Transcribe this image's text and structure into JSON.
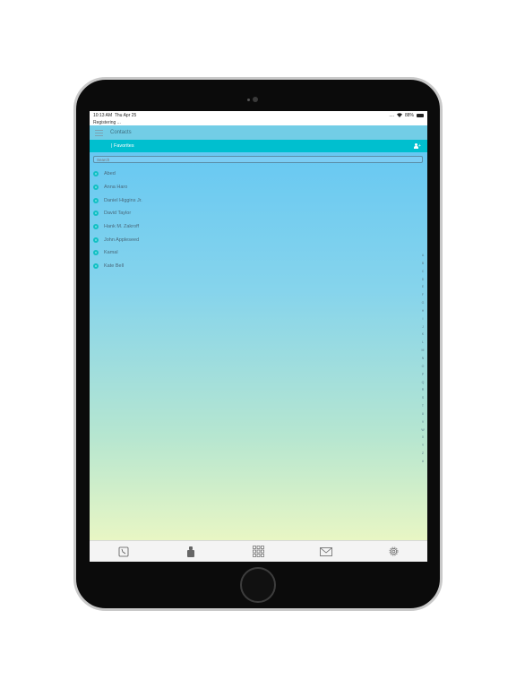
{
  "status_bar": {
    "time": "10:13 AM",
    "date": "Thu Apr 25",
    "signal": "....",
    "battery": "88%"
  },
  "registering_text": "Registering ...",
  "header": {
    "title": "Contacts",
    "menu_icon": "hamburger-icon"
  },
  "favorites_bar": {
    "label": "| Favorites",
    "add_icon": "add-user-icon"
  },
  "search": {
    "placeholder": "Search",
    "value": ""
  },
  "contacts": [
    {
      "name": "Abed"
    },
    {
      "name": "Anna Haro"
    },
    {
      "name": "Daniel Higgins Jr."
    },
    {
      "name": "David Taylor"
    },
    {
      "name": "Hank M. Zakroff"
    },
    {
      "name": "John Appleseed"
    },
    {
      "name": "Kamal"
    },
    {
      "name": "Kate Bell"
    }
  ],
  "index_letters": [
    "A",
    "B",
    "C",
    "D",
    "E",
    "F",
    "G",
    "H",
    "I",
    "J",
    "K",
    "L",
    "M",
    "N",
    "O",
    "P",
    "Q",
    "R",
    "S",
    "T",
    "U",
    "V",
    "W",
    "X",
    "Y",
    "Z",
    "#"
  ],
  "tabs": [
    {
      "name": "phone",
      "icon": "phone-icon"
    },
    {
      "name": "contacts",
      "icon": "contacts-icon"
    },
    {
      "name": "keypad",
      "icon": "keypad-icon"
    },
    {
      "name": "messages",
      "icon": "mail-icon"
    },
    {
      "name": "settings",
      "icon": "gear-icon"
    }
  ],
  "colors": {
    "header_bg": "#72cde6",
    "favorites_bg": "#00bfcf",
    "avatar": "#13c0c4",
    "gradient_top": "#62c6f3",
    "gradient_bottom": "#e8f6c4"
  }
}
